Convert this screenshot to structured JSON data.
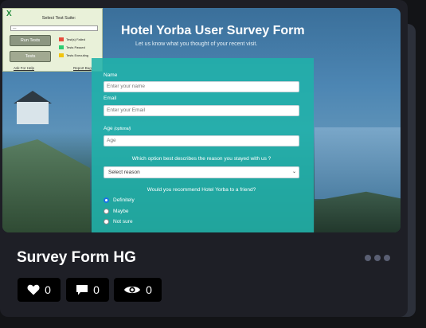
{
  "tool_panel": {
    "close_glyph": "X",
    "title": "Select Test Suite:",
    "select_value": "---",
    "run_button": "Run Tests",
    "tests_button": "Tests",
    "legend": [
      {
        "label": "Test(s) Failed",
        "color": "#e74c3c"
      },
      {
        "label": "Tests Passed",
        "color": "#2ecc71"
      },
      {
        "label": "Tests Executing",
        "color": "#f1c40f"
      }
    ],
    "help_link": "Ask For Help",
    "bug_link": "Report Bug"
  },
  "form": {
    "title": "Hotel Yorba User Survey Form",
    "subtitle": "Let us know what you thought of your recent visit.",
    "name_label": "Name",
    "name_placeholder": "Enter your name",
    "email_label": "Email",
    "email_placeholder": "Enter your Email",
    "age_label": "Age",
    "age_optional": "(optional)",
    "age_placeholder": "Age",
    "reason_question": "Which option best describes the reason you stayed with us ?",
    "reason_select": "Select reason",
    "recommend_question": "Would you recommend Hotel Yorba to a friend?",
    "radio_options": [
      "Definitely",
      "Maybe",
      "Not sure"
    ],
    "selected_option": "Definitely"
  },
  "card": {
    "title": "Survey Form HG",
    "likes": "0",
    "comments": "0",
    "views": "0"
  },
  "colors": {
    "page_bg": "#131417",
    "card_bg": "#1e1f26",
    "panel": "#20b2aa",
    "stat_bg": "#000000"
  }
}
